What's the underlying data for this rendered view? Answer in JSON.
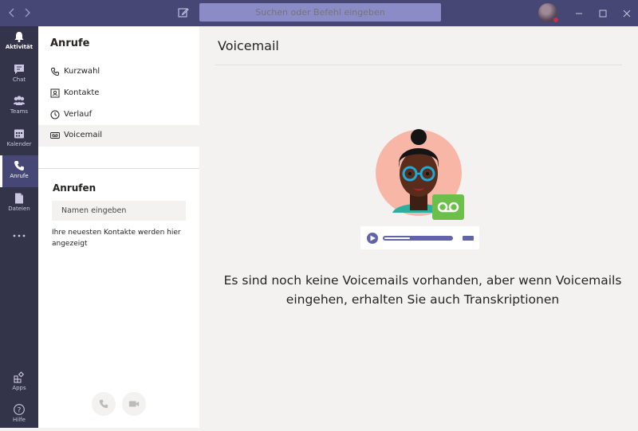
{
  "titlebar": {
    "search_placeholder": "Suchen oder Befehl eingeben",
    "accent": "#464775",
    "search_color": "#8b8cc7"
  },
  "rail": {
    "items": [
      {
        "label": "Aktivität",
        "icon": "bell-icon"
      },
      {
        "label": "Chat",
        "icon": "chat-icon"
      },
      {
        "label": "Teams",
        "icon": "teams-icon"
      },
      {
        "label": "Kalender",
        "icon": "calendar-icon"
      },
      {
        "label": "Anrufe",
        "icon": "phone-icon"
      },
      {
        "label": "Dateien",
        "icon": "file-icon"
      },
      {
        "label": "",
        "icon": "more-icon"
      }
    ],
    "bottom": [
      {
        "label": "Apps",
        "icon": "apps-icon"
      },
      {
        "label": "Hilfe",
        "icon": "help-icon"
      }
    ],
    "active": "Anrufe"
  },
  "panel": {
    "title": "Anrufe",
    "menu": [
      {
        "label": "Kurzwahl",
        "icon": "phone-icon"
      },
      {
        "label": "Kontakte",
        "icon": "contacts-icon"
      },
      {
        "label": "Verlauf",
        "icon": "clock-icon"
      },
      {
        "label": "Voicemail",
        "icon": "voicemail-icon"
      }
    ],
    "selected": "Voicemail",
    "call_section_title": "Anrufen",
    "name_placeholder": "Namen eingeben",
    "hint": "Ihre neuesten Kontakte werden hier angezeigt"
  },
  "main": {
    "title": "Voicemail",
    "empty_message": "Es sind noch keine Voicemails vorhanden, aber wenn Voicemails eingehen, erhalten Sie auch Transkriptionen"
  }
}
